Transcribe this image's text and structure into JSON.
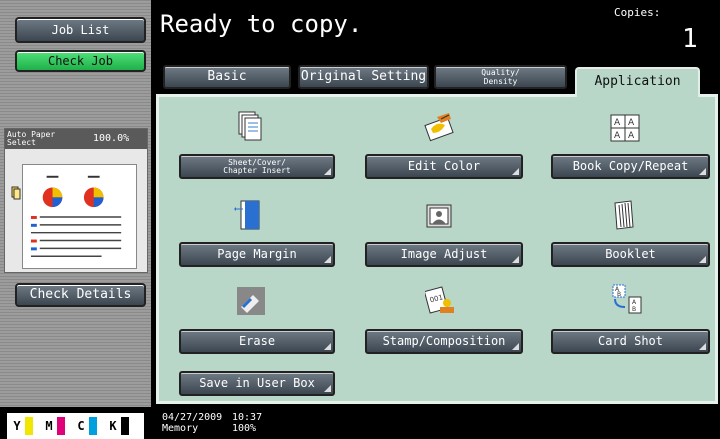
{
  "left": {
    "job_list": "Job List",
    "check_job": "Check Job",
    "paper_label": "Auto Paper\nSelect",
    "zoom": "100.0%",
    "check_details": "Check Details",
    "toner": [
      "Y",
      "M",
      "C",
      "K"
    ]
  },
  "header": {
    "status": "Ready to copy.",
    "copies_label": "Copies:",
    "copies_value": "1"
  },
  "tabs": {
    "basic": "Basic",
    "original": "Original Setting",
    "quality": "Quality/\nDensity",
    "application": "Application"
  },
  "functions": {
    "sheet_cover": "Sheet/Cover/\nChapter Insert",
    "edit_color": "Edit Color",
    "book_copy": "Book Copy/Repeat",
    "page_margin": "Page Margin",
    "image_adjust": "Image Adjust",
    "booklet": "Booklet",
    "erase": "Erase",
    "stamp": "Stamp/Composition",
    "card_shot": "Card Shot",
    "save_user_box": "Save in User Box"
  },
  "footer": {
    "date": "04/27/2009",
    "mode": "Memory",
    "time": "10:37",
    "memory_pct": "100%"
  },
  "colors": {
    "panel_bg": "#b8d7c8",
    "button_dark": "#3c4650",
    "check_job_green": "#20b04a",
    "toner_y": "#f2e600",
    "toner_m": "#e0007a",
    "toner_c": "#00a0e0",
    "toner_k": "#000000"
  }
}
